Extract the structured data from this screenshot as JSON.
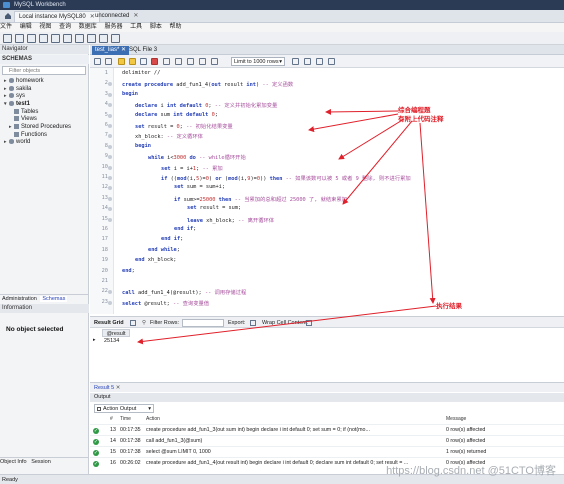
{
  "app": {
    "title": "MySQL Workbench"
  },
  "connection_tabs": [
    {
      "label": "Local instance MySQL80"
    },
    {
      "label": "unconnected"
    }
  ],
  "menu": [
    "文件",
    "编辑",
    "视图",
    "查询",
    "数据库",
    "服务器",
    "工具",
    "脚本",
    "帮助"
  ],
  "navigator": {
    "title": "Navigator",
    "schemas_label": "SCHEMAS",
    "filter_placeholder": "Filter objects",
    "schemas": [
      {
        "label": "homework",
        "expanded": false
      },
      {
        "label": "sakila",
        "expanded": false
      },
      {
        "label": "sys",
        "expanded": false
      },
      {
        "label": "test1",
        "expanded": true
      },
      {
        "label": "Tables",
        "child": true
      },
      {
        "label": "Views",
        "child": true
      },
      {
        "label": "Stored Procedures",
        "child": true
      },
      {
        "label": "Functions",
        "child": true
      },
      {
        "label": "world",
        "expanded": false
      }
    ],
    "bottom_tabs": [
      "Administration",
      "Schemas"
    ],
    "info_label": "Information",
    "no_object": "No object selected",
    "info_tabs": [
      "Object Info",
      "Session"
    ]
  },
  "editor": {
    "tabs": [
      "test_lias*",
      "SQL File 3"
    ],
    "limit_label": "Limit to 1000 rows",
    "lines": [
      {
        "n": "1",
        "indent": 0,
        "parts": [
          [
            "",
            "delimiter //"
          ]
        ]
      },
      {
        "n": "2",
        "indent": 0,
        "dot": true,
        "parts": [
          [
            "kw",
            "create procedure "
          ],
          [
            "",
            "add_fun1_4("
          ],
          [
            "kw",
            "out "
          ],
          [
            "",
            "result "
          ],
          [
            "kw",
            "int"
          ],
          [
            "",
            ") "
          ],
          [
            "cm",
            "-- 定义函数"
          ]
        ]
      },
      {
        "n": "3",
        "indent": 0,
        "dot": true,
        "parts": [
          [
            "kw",
            "begin"
          ]
        ]
      },
      {
        "n": "4",
        "indent": 1,
        "dot": true,
        "parts": [
          [
            "kw",
            "declare "
          ],
          [
            "",
            "i "
          ],
          [
            "kw",
            "int default "
          ],
          [
            "nm",
            "0"
          ],
          [
            "",
            "; "
          ],
          [
            "cm",
            "-- 定义并初始化累加变量"
          ]
        ]
      },
      {
        "n": "5",
        "indent": 1,
        "dot": true,
        "parts": [
          [
            "kw",
            "declare "
          ],
          [
            "",
            "sum "
          ],
          [
            "kw",
            "int default "
          ],
          [
            "nm",
            "0"
          ],
          [
            "",
            ";"
          ]
        ]
      },
      {
        "n": "6",
        "indent": 1,
        "dot": true,
        "parts": [
          [
            "kw",
            "set "
          ],
          [
            "",
            "result = "
          ],
          [
            "nm",
            "0"
          ],
          [
            "",
            "; "
          ],
          [
            "cm",
            "-- 初始化结果变量"
          ]
        ]
      },
      {
        "n": "7",
        "indent": 1,
        "dot": true,
        "parts": [
          [
            "",
            "xh_block: "
          ],
          [
            "cm",
            "-- 定义循环体"
          ]
        ]
      },
      {
        "n": "8",
        "indent": 1,
        "dot": true,
        "parts": [
          [
            "kw",
            "begin"
          ]
        ]
      },
      {
        "n": "9",
        "indent": 2,
        "dot": true,
        "parts": [
          [
            "kw",
            "while "
          ],
          [
            "",
            "i<"
          ],
          [
            "nm",
            "3000"
          ],
          [
            "kw",
            " do "
          ],
          [
            "cm",
            "-- while循环开始"
          ]
        ]
      },
      {
        "n": "10",
        "indent": 3,
        "dot": true,
        "parts": [
          [
            "kw",
            "set "
          ],
          [
            "",
            "i = i+"
          ],
          [
            "nm",
            "1"
          ],
          [
            "",
            "; "
          ],
          [
            "cm",
            "-- 累加"
          ]
        ]
      },
      {
        "n": "11",
        "indent": 3,
        "dot": true,
        "parts": [
          [
            "kw",
            "if "
          ],
          [
            "",
            "(("
          ],
          [
            "kw",
            "mod"
          ],
          [
            "",
            "(i,"
          ],
          [
            "nm",
            "5"
          ],
          [
            "",
            ")="
          ],
          [
            "nm",
            "0"
          ],
          [
            "",
            ") "
          ],
          [
            "kw",
            "or "
          ],
          [
            "",
            "("
          ],
          [
            "kw",
            "mod"
          ],
          [
            "",
            "(i,"
          ],
          [
            "nm",
            "9"
          ],
          [
            "",
            ")="
          ],
          [
            "nm",
            "0"
          ],
          [
            "",
            ")) "
          ],
          [
            "kw",
            "then "
          ],
          [
            "cm",
            "-- 如果该数可以被 5 或者 9 整除, 则不进行累加"
          ]
        ]
      },
      {
        "n": "12",
        "indent": 4,
        "dot": true,
        "parts": [
          [
            "kw",
            "set "
          ],
          [
            "",
            "sum = sum+i;"
          ]
        ]
      },
      {
        "n": "13",
        "indent": 4,
        "dot": true,
        "parts": [
          [
            "kw",
            "if "
          ],
          [
            "",
            "sum>="
          ],
          [
            "nm",
            "25000"
          ],
          [
            "kw",
            " then "
          ],
          [
            "cm",
            "-- 当累加的总和超过 25000 了, 就结束累加"
          ]
        ]
      },
      {
        "n": "14",
        "indent": 5,
        "dot": true,
        "parts": [
          [
            "kw",
            "set "
          ],
          [
            "",
            "result = sum;"
          ]
        ]
      },
      {
        "n": "15",
        "indent": 5,
        "dot": true,
        "parts": [
          [
            "kw",
            "leave "
          ],
          [
            "",
            "xh_block; "
          ],
          [
            "cm",
            "-- 离开循环体"
          ]
        ]
      },
      {
        "n": "16",
        "indent": 4,
        "parts": [
          [
            "kw",
            "end if"
          ],
          [
            "",
            ";"
          ]
        ]
      },
      {
        "n": "17",
        "indent": 3,
        "parts": [
          [
            "kw",
            "end if"
          ],
          [
            "",
            ";"
          ]
        ]
      },
      {
        "n": "18",
        "indent": 2,
        "parts": [
          [
            "kw",
            "end while"
          ],
          [
            "",
            ";"
          ]
        ]
      },
      {
        "n": "19",
        "indent": 1,
        "parts": [
          [
            "kw",
            "end "
          ],
          [
            "",
            "xh_block;"
          ]
        ]
      },
      {
        "n": "20",
        "indent": 0,
        "parts": [
          [
            "kw",
            "end"
          ],
          [
            "",
            ";"
          ]
        ]
      },
      {
        "n": "21",
        "indent": 0,
        "parts": []
      },
      {
        "n": "22",
        "indent": 0,
        "dot": true,
        "parts": [
          [
            "kw",
            "call "
          ],
          [
            "",
            "add_fun1_4(@result); "
          ],
          [
            "cm",
            "-- 调用存储过程"
          ]
        ]
      },
      {
        "n": "23",
        "indent": 0,
        "dot": true,
        "parts": [
          [
            "kw",
            "select "
          ],
          [
            "",
            "@result; "
          ],
          [
            "cm",
            "-- 查询变量值"
          ]
        ]
      }
    ]
  },
  "annotations": {
    "note1": "综合编程题\n有附上代码注释",
    "note2": "执行结果",
    "color": "#e0202a"
  },
  "result": {
    "grid_label": "Result Grid",
    "filter_label": "Filter Rows:",
    "export_label": "Export:",
    "wrap_label": "Wrap Cell Content:",
    "column": "@result",
    "value": "25134",
    "tab_label": "Result 5"
  },
  "output": {
    "title": "Output",
    "selector": "Action Output",
    "headers": [
      "#",
      "Time",
      "Action",
      "Message"
    ],
    "rows": [
      {
        "n": "13",
        "time": "00:17:35",
        "action": "create procedure add_fun1_3(out sum int) begin declare i int default 0; set sum = 0;  if (not(mo...",
        "message": "0 row(s) affected"
      },
      {
        "n": "14",
        "time": "00:17:38",
        "action": "call add_fun1_3(@sum)",
        "message": "0 row(s) affected"
      },
      {
        "n": "15",
        "time": "00:17:38",
        "action": "select @sum LIMIT 0, 1000",
        "message": "1 row(s) returned"
      },
      {
        "n": "16",
        "time": "00:26:02",
        "action": "create procedure add_fun1_4(out result int) begin declare i int default 0;  declare sum int default 0;  set result = ...",
        "message": "0 row(s) affected"
      }
    ]
  },
  "status": "Ready",
  "watermark": "https://blog.csdn.net @51CTO博客"
}
